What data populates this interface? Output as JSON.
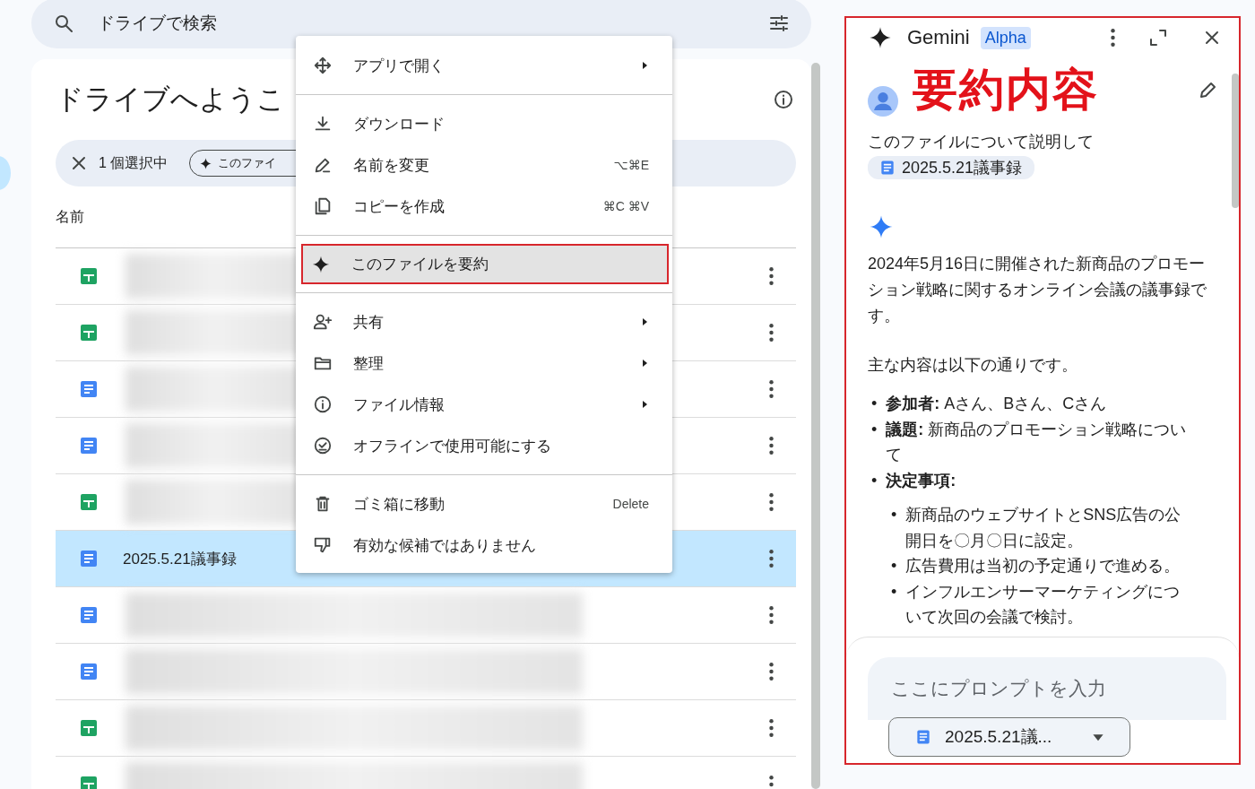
{
  "search": {
    "placeholder": "ドライブで検索"
  },
  "main": {
    "title": "ドライブへようこ",
    "selection_bar": {
      "count": "1 個選択中",
      "chip": "このファイ"
    },
    "column_header": "名前",
    "rows": [
      {
        "kind": "sheet",
        "selected": false
      },
      {
        "kind": "sheet",
        "selected": false
      },
      {
        "kind": "doc",
        "selected": false
      },
      {
        "kind": "doc",
        "selected": false
      },
      {
        "kind": "sheet",
        "selected": false
      },
      {
        "kind": "doc",
        "name": "2025.5.21議事録",
        "selected": true
      },
      {
        "kind": "doc",
        "selected": false
      },
      {
        "kind": "doc",
        "selected": false
      },
      {
        "kind": "sheet",
        "selected": false
      },
      {
        "kind": "sheet",
        "selected": false
      }
    ]
  },
  "context_menu": {
    "groups": [
      [
        {
          "label": "アプリで開く",
          "submenu": true,
          "highlighted": false
        }
      ],
      [
        {
          "label": "ダウンロード",
          "submenu": false,
          "highlighted": false
        },
        {
          "label": "名前を変更",
          "shortcut": "⌥⌘E",
          "submenu": false,
          "highlighted": false
        },
        {
          "label": "コピーを作成",
          "shortcut": "⌘C ⌘V",
          "submenu": false,
          "highlighted": false
        }
      ],
      [
        {
          "label": "このファイルを要約",
          "submenu": false,
          "highlighted": true
        }
      ],
      [
        {
          "label": "共有",
          "submenu": true,
          "highlighted": false
        },
        {
          "label": "整理",
          "submenu": true,
          "highlighted": false
        },
        {
          "label": "ファイル情報",
          "submenu": true,
          "highlighted": false
        },
        {
          "label": "オフラインで使用可能にする",
          "submenu": false,
          "highlighted": false
        }
      ],
      [
        {
          "label": "ゴミ箱に移動",
          "shortcut": "Delete",
          "submenu": false,
          "highlighted": false
        },
        {
          "label": "有効な候補ではありません",
          "submenu": false,
          "highlighted": false
        }
      ]
    ]
  },
  "gemini": {
    "title": "Gemini",
    "badge": "Alpha",
    "annotation": "要約内容",
    "prompt": "このファイルについて説明して",
    "prompt_file": "2025.5.21議事録",
    "response": [
      {
        "kind": "paragraph",
        "text": "2024年5月16日に開催された新商品のプロモーション戦略に関するオンライン会議の議事録です。"
      },
      {
        "kind": "paragraph",
        "text": "主な内容は以下の通りです。"
      },
      {
        "kind": "list",
        "items": [
          {
            "bullet": "•",
            "text": "**参加者:** Aさん、Bさん、Cさん"
          },
          {
            "bullet": "•",
            "text": "**議題:** 新商品のプロモーション戦略について"
          },
          {
            "bullet": "•",
            "text": "**決定事項:**",
            "children": [
              {
                "bullet": "•",
                "text": "新商品のウェブサイトとSNS広告の公開日を〇月〇日に設定。"
              },
              {
                "bullet": "•",
                "text": "広告費用は当初の予定通りで進める。"
              },
              {
                "bullet": "•",
                "text": "インフルエンサーマーケティングについて次回の会議で検討。"
              }
            ]
          }
        ]
      }
    ],
    "input": {
      "placeholder": "ここにプロンプトを入力",
      "file": "2025.5.21議..."
    }
  }
}
